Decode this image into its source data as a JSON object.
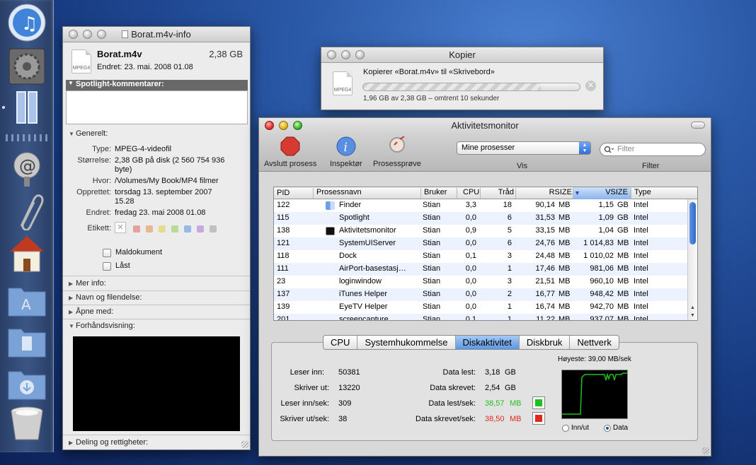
{
  "dock": {
    "icons": [
      "itunes-icon",
      "system-preferences-icon",
      "column-view-icon",
      "mail-icon",
      "paperclip-icon",
      "home-folder-icon",
      "applications-folder-icon",
      "documents-folder-icon",
      "downloads-folder-icon",
      "trash-icon"
    ]
  },
  "info": {
    "title": "Borat.m4v-info",
    "file_name": "Borat.m4v",
    "size": "2,38 GB",
    "modified": "Endret: 23. mai. 2008 01.08",
    "icon_caption": "MPEG4",
    "spotlight_header": "Spotlight-kommentarer:",
    "general_header": "Generelt:",
    "general": [
      {
        "label": "Type:",
        "value": "MPEG-4-videofil"
      },
      {
        "label": "Størrelse:",
        "value": "2,38 GB på disk (2 560 754 936",
        "value2": "byte)"
      },
      {
        "label": "Hvor:",
        "value": "/Volumes/My Book/MP4 filmer"
      },
      {
        "label": "Opprettet:",
        "value": "torsdag 13. september 2007",
        "value2": "15.28"
      },
      {
        "label": "Endret:",
        "value": "fredag 23. mai 2008 01.08"
      }
    ],
    "label_caption": "Etikett:",
    "label_colors": [
      "#e6a0a0",
      "#e8b890",
      "#e6dc90",
      "#b8dc98",
      "#98b8e6",
      "#c8a8dc",
      "#c0c0c0"
    ],
    "checkboxes": [
      "Maldokument",
      "Låst"
    ],
    "sections": [
      "Mer info:",
      "Navn og filendelse:",
      "Åpne med:",
      "Forhåndsvisning:",
      "Deling og rettigheter:"
    ]
  },
  "copy": {
    "title": "Kopier",
    "message": "Kopierer «Borat.m4v» til «Skrivebord»",
    "status": "1,96 GB av 2,38 GB – omtrent 10 sekunder",
    "icon_caption": "MPEG4",
    "progress": 0.82
  },
  "monitor": {
    "title": "Aktivitetsmonitor",
    "toolbar": {
      "quit": "Avslutt prosess",
      "inspect": "Inspektør",
      "sample": "Prosessprøve",
      "show_value": "Mine prosesser",
      "show_caption": "Vis",
      "filter_placeholder": "Filter",
      "filter_caption": "Filter"
    },
    "columns": [
      "PID",
      "Prosessnavn",
      "Bruker",
      "CPU",
      "Tråd",
      "RSIZE",
      "VSIZE",
      "Type"
    ],
    "processes": [
      {
        "pid": "122",
        "name": "Finder",
        "user": "Stian",
        "cpu": "3,3",
        "threads": "18",
        "rsize": "90,14",
        "ru": "MB",
        "vsize": "1,15",
        "vu": "GB",
        "type": "Intel",
        "icon": "finder-icon"
      },
      {
        "pid": "115",
        "name": "Spotlight",
        "user": "Stian",
        "cpu": "0,0",
        "threads": "6",
        "rsize": "31,53",
        "ru": "MB",
        "vsize": "1,09",
        "vu": "GB",
        "type": "Intel",
        "icon": ""
      },
      {
        "pid": "138",
        "name": "Aktivitetsmonitor",
        "user": "Stian",
        "cpu": "0,9",
        "threads": "5",
        "rsize": "33,15",
        "ru": "MB",
        "vsize": "1,04",
        "vu": "GB",
        "type": "Intel",
        "icon": "activity-monitor-icon"
      },
      {
        "pid": "121",
        "name": "SystemUIServer",
        "user": "Stian",
        "cpu": "0,0",
        "threads": "6",
        "rsize": "24,76",
        "ru": "MB",
        "vsize": "1 014,83",
        "vu": "MB",
        "type": "Intel",
        "icon": ""
      },
      {
        "pid": "118",
        "name": "Dock",
        "user": "Stian",
        "cpu": "0,1",
        "threads": "3",
        "rsize": "24,48",
        "ru": "MB",
        "vsize": "1 010,02",
        "vu": "MB",
        "type": "Intel",
        "icon": ""
      },
      {
        "pid": "111",
        "name": "AirPort-basestasj…",
        "user": "Stian",
        "cpu": "0,0",
        "threads": "1",
        "rsize": "17,46",
        "ru": "MB",
        "vsize": "981,06",
        "vu": "MB",
        "type": "Intel",
        "icon": ""
      },
      {
        "pid": "23",
        "name": "loginwindow",
        "user": "Stian",
        "cpu": "0,0",
        "threads": "3",
        "rsize": "21,51",
        "ru": "MB",
        "vsize": "960,10",
        "vu": "MB",
        "type": "Intel",
        "icon": ""
      },
      {
        "pid": "137",
        "name": "iTunes Helper",
        "user": "Stian",
        "cpu": "0,0",
        "threads": "2",
        "rsize": "16,77",
        "ru": "MB",
        "vsize": "948,42",
        "vu": "MB",
        "type": "Intel",
        "icon": ""
      },
      {
        "pid": "139",
        "name": "EyeTV Helper",
        "user": "Stian",
        "cpu": "0,0",
        "threads": "1",
        "rsize": "16,74",
        "ru": "MB",
        "vsize": "942,70",
        "vu": "MB",
        "type": "Intel",
        "icon": ""
      },
      {
        "pid": "201",
        "name": "screencapture",
        "user": "Stian",
        "cpu": "0,1",
        "threads": "1",
        "rsize": "11,22",
        "ru": "MB",
        "vsize": "937,07",
        "vu": "MB",
        "type": "Intel",
        "icon": ""
      }
    ],
    "tabs": [
      "CPU",
      "Systemhukommelse",
      "Diskaktivitet",
      "Diskbruk",
      "Nettverk"
    ],
    "active_tab": "Diskaktivitet",
    "disk": {
      "reads_in_label": "Leser inn:",
      "reads_in": "50381",
      "writes_out_label": "Skriver ut:",
      "writes_out": "13220",
      "reads_sec_label": "Leser inn/sek:",
      "reads_sec": "309",
      "writes_sec_label": "Skriver ut/sek:",
      "writes_sec": "38",
      "data_read_label": "Data lest:",
      "data_read": "3,18",
      "data_read_unit": "GB",
      "data_written_label": "Data skrevet:",
      "data_written": "2,54",
      "data_written_unit": "GB",
      "read_sec_label": "Data lest/sek:",
      "read_sec": "38,57",
      "read_sec_unit": "MB",
      "written_sec_label": "Data skrevet/sek:",
      "written_sec": "38,50",
      "written_sec_unit": "MB",
      "peak": "Høyeste: 39,00 MB/sek",
      "radio_io": "Inn/ut",
      "radio_data": "Data",
      "read_color": "#1ec01e",
      "write_color": "#e0281e"
    }
  }
}
